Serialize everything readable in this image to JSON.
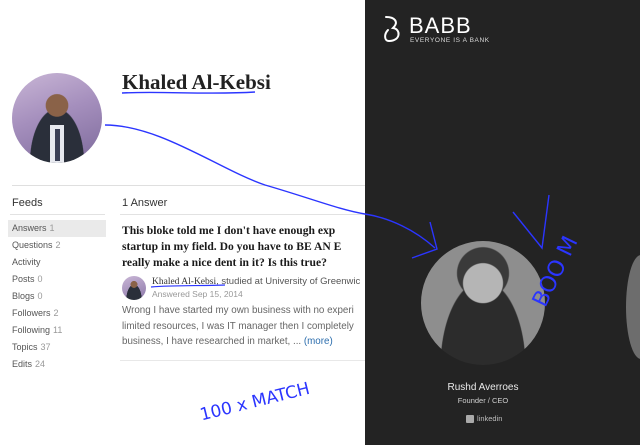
{
  "profile": {
    "name": "Khaled Al-Kebsi"
  },
  "feeds": {
    "title": "Feeds",
    "items": [
      {
        "label": "Answers",
        "count": "1"
      },
      {
        "label": "Questions",
        "count": "2"
      },
      {
        "label": "Activity",
        "count": ""
      },
      {
        "label": "Posts",
        "count": "0"
      },
      {
        "label": "Blogs",
        "count": "0"
      },
      {
        "label": "Followers",
        "count": "2"
      },
      {
        "label": "Following",
        "count": "11"
      },
      {
        "label": "Topics",
        "count": "37"
      },
      {
        "label": "Edits",
        "count": "24"
      }
    ]
  },
  "answers": {
    "count_label": "1 Answer",
    "question_lines": [
      "This bloke told me I don't have enough exp",
      "startup in my field. Do you have to BE AN E",
      "really make a nice dent in it? Is this true?"
    ],
    "author_name": "Khaled Al-Kebsi",
    "author_credential": ", studied at University of Greenwic",
    "answered": "Answered Sep 15, 2014",
    "body_lines": [
      "Wrong I have started my own business with no experi",
      "limited resources, I was IT manager then I completely",
      "business, I have researched in market, ... "
    ],
    "more_label": "(more)"
  },
  "brand": {
    "name": "BABB",
    "tagline": "EVERYONE IS A BANK"
  },
  "founder": {
    "name": "Rushd Averroes",
    "role": "Founder / CEO",
    "link_label": "linkedin"
  },
  "annotations": {
    "boom": "BOO M",
    "match": "100 x MATCH",
    "color": "#2b35ff"
  },
  "colors": {
    "dark_panel": "#232323",
    "link": "#2b6dad"
  }
}
